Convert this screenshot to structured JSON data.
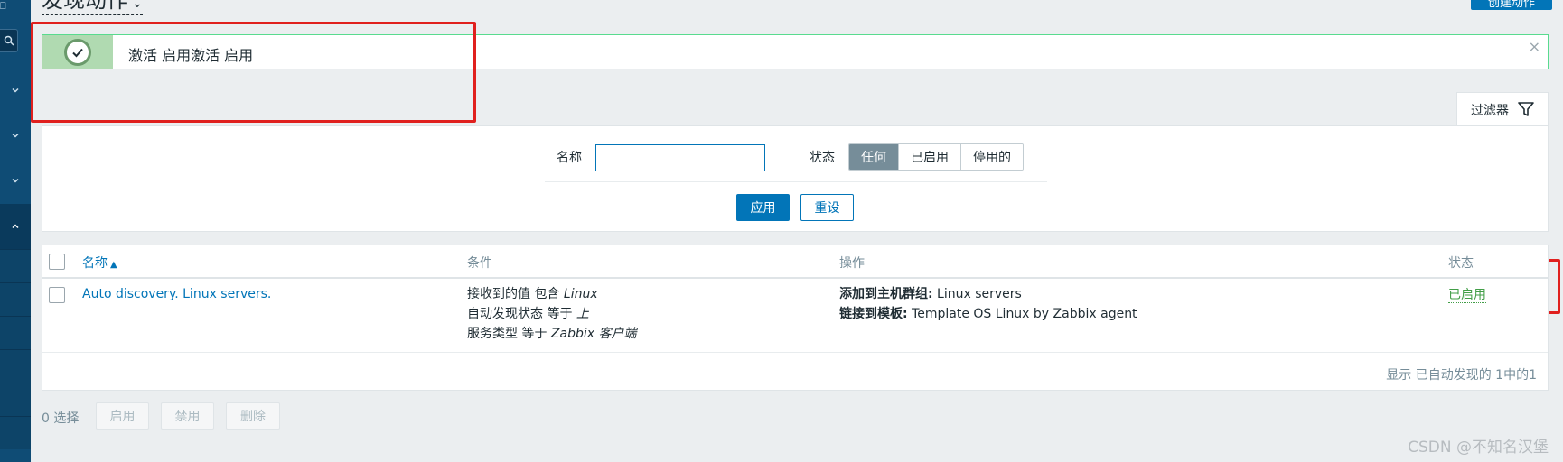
{
  "page": {
    "title": "发现动作",
    "create_button": "创建动作"
  },
  "message": {
    "text": "激活 启用激活 启用",
    "close_glyph": "×"
  },
  "filter": {
    "tab_label": "过滤器",
    "name_label": "名称",
    "name_value": "",
    "status_label": "状态",
    "status_options": [
      "任何",
      "已启用",
      "停用的"
    ],
    "status_selected": "任何",
    "apply_label": "应用",
    "reset_label": "重设"
  },
  "table": {
    "columns": {
      "name": "名称",
      "sort_indicator": "▲",
      "conditions": "条件",
      "operations": "操作",
      "status": "状态"
    },
    "rows": [
      {
        "name": "Auto discovery. Linux servers.",
        "conditions": [
          {
            "label": "接收到的值 包含 ",
            "value": "Linux"
          },
          {
            "label": "自动发现状态 等于 ",
            "value": "上"
          },
          {
            "label": "服务类型 等于 ",
            "value": "Zabbix 客户端"
          }
        ],
        "operations": [
          {
            "label": "添加到主机群组:",
            "value": " Linux servers"
          },
          {
            "label": "链接到模板:",
            "value": " Template OS Linux by Zabbix agent"
          }
        ],
        "status": "已启用"
      }
    ],
    "footer": "显示 已自动发现的 1中的1"
  },
  "actions": {
    "selected_count": "0 选择",
    "enable": "启用",
    "disable": "禁用",
    "delete": "删除"
  },
  "watermark": "CSDN @不知名汉堡",
  "colors": {
    "nav_bg": "#0f4c75",
    "primary": "#0275b8",
    "success_border": "#59db8f",
    "enabled_status": "#429e47",
    "annotation": "#e0201e"
  }
}
